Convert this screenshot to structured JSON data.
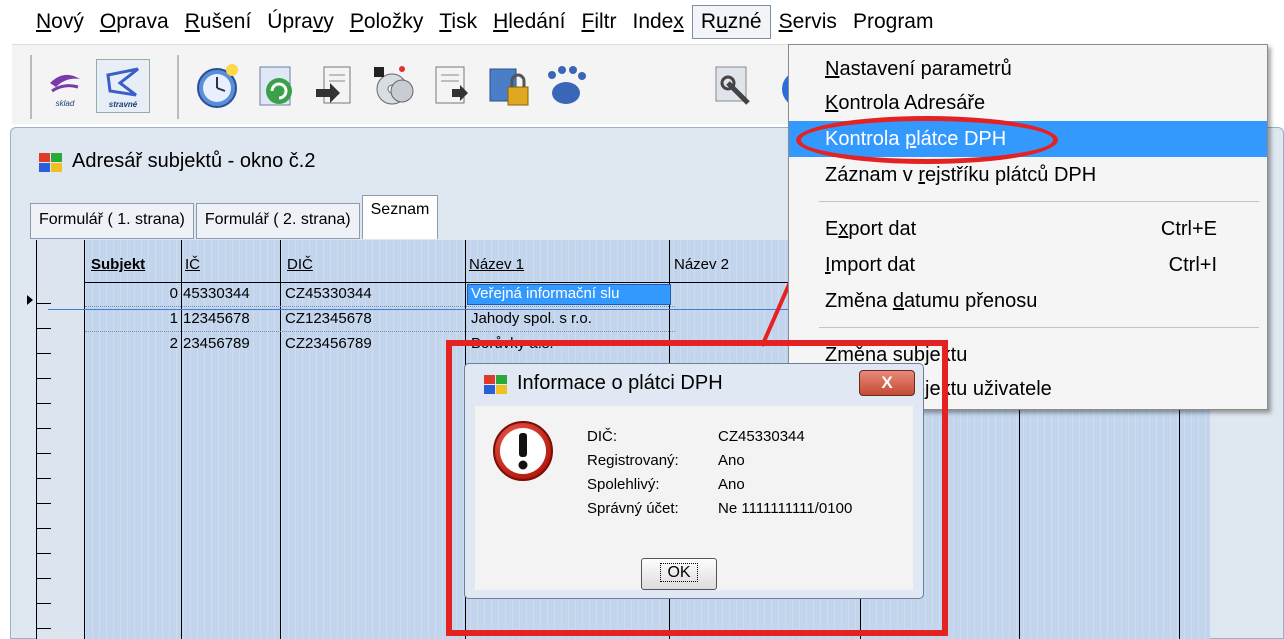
{
  "menubar": {
    "items": [
      {
        "pre": "",
        "u": "N",
        "post": "ový"
      },
      {
        "pre": "",
        "u": "O",
        "post": "prava"
      },
      {
        "pre": "",
        "u": "R",
        "post": "ušení"
      },
      {
        "pre": "Úpra",
        "u": "v",
        "post": "y"
      },
      {
        "pre": "",
        "u": "P",
        "post": "oložky"
      },
      {
        "pre": "",
        "u": "T",
        "post": "isk"
      },
      {
        "pre": "",
        "u": "H",
        "post": "ledání"
      },
      {
        "pre": "",
        "u": "F",
        "post": "iltr"
      },
      {
        "pre": "Inde",
        "u": "x",
        "post": ""
      },
      {
        "pre": "R",
        "u": "u",
        "post": "zné"
      },
      {
        "pre": "",
        "u": "S",
        "post": "ervis"
      },
      {
        "pre": "Pro",
        "u": "g",
        "post": "ram"
      }
    ]
  },
  "toolbar": {
    "sklad_label": "sklad",
    "stravne_label": "stravné"
  },
  "window": {
    "title": "Adresář subjektů - okno č.2"
  },
  "tabs": [
    {
      "label": "Formulář ( 1. strana)"
    },
    {
      "label": "Formulář ( 2. strana)"
    },
    {
      "label": "Seznam"
    }
  ],
  "grid": {
    "headers": [
      "Subjekt",
      "IČ",
      "DIČ",
      "Název 1",
      "Název 2"
    ],
    "rows": [
      {
        "subjekt": "0",
        "ic": "45330344",
        "dic": "CZ45330344",
        "nazev1": "Veřejná informační slu",
        "nazev2": ""
      },
      {
        "subjekt": "1",
        "ic": "12345678",
        "dic": "CZ12345678",
        "nazev1": "Jahody spol. s r.o.",
        "nazev2": ""
      },
      {
        "subjekt": "2",
        "ic": "23456789",
        "dic": "CZ23456789",
        "nazev1": "Borůvky a.s.",
        "nazev2": ""
      }
    ]
  },
  "dropdown": {
    "items": [
      {
        "pre": "",
        "u": "N",
        "post": "astavení parametrů",
        "shortcut": ""
      },
      {
        "pre": "",
        "u": "K",
        "post": "ontrola Adresáře",
        "shortcut": ""
      },
      {
        "pre": "Kontrola ",
        "u": "p",
        "post": "látce DPH",
        "shortcut": ""
      },
      {
        "pre": "Záznam v ",
        "u": "r",
        "post": "ejstříku plátců DPH",
        "shortcut": ""
      },
      {
        "pre": "E",
        "u": "x",
        "post": "port dat",
        "shortcut": "Ctrl+E"
      },
      {
        "pre": "",
        "u": "I",
        "post": "mport dat",
        "shortcut": "Ctrl+I"
      },
      {
        "pre": "Změna ",
        "u": "d",
        "post": "atumu přenosu",
        "shortcut": ""
      },
      {
        "pre": "Změna sub",
        "u": "j",
        "post": "ektu",
        "shortcut": ""
      },
      {
        "pre": "Změna subjektu uživatele",
        "u": "",
        "post": "",
        "shortcut": ""
      }
    ],
    "highlight_color": "#3399ff"
  },
  "dialog": {
    "title": "Informace o plátci DPH",
    "close_glyph": "X",
    "labels": [
      "DIČ:",
      "Registrovaný:",
      "Spolehlivý:",
      "Správný účet:"
    ],
    "values": [
      "CZ45330344",
      "Ano",
      "Ano",
      "Ne 1111111111/0100"
    ],
    "ok_label": "OK",
    "icon": "exclamation-icon"
  },
  "annotation": {
    "color": "#e52222"
  }
}
